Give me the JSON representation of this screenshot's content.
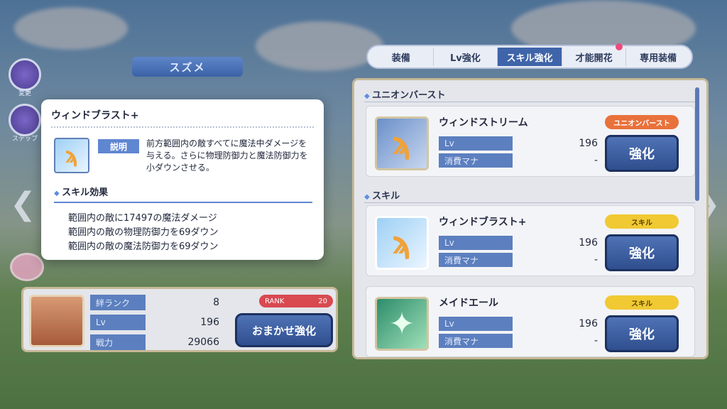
{
  "character": {
    "name": "スズメ"
  },
  "side_buttons": [
    {
      "label": "変更"
    },
    {
      "label": "ステップ"
    }
  ],
  "tabs": [
    {
      "label": "装備",
      "active": false
    },
    {
      "label": "Lv強化",
      "active": false
    },
    {
      "label": "スキル強化",
      "active": true
    },
    {
      "label": "才能開花",
      "active": false,
      "notify": true
    },
    {
      "label": "専用装備",
      "active": false
    }
  ],
  "sections": {
    "union_burst": "ユニオンバースト",
    "skill": "スキル"
  },
  "skills": [
    {
      "name": "ウィンドストリーム",
      "badge": "ユニオンバースト",
      "lv_label": "Lv",
      "lv": "196",
      "mana_label": "消費マナ",
      "mana": "-",
      "button": "強化",
      "icon": "wind-staff-icon"
    },
    {
      "name": "ウィンドブラスト+",
      "badge": "スキル",
      "lv_label": "Lv",
      "lv": "196",
      "mana_label": "消費マナ",
      "mana": "-",
      "button": "強化",
      "icon": "wind-staff-icon"
    },
    {
      "name": "メイドエール",
      "badge": "スキル",
      "lv_label": "Lv",
      "lv": "196",
      "mana_label": "消費マナ",
      "mana": "-",
      "button": "強化",
      "icon": "sparkle-sword-icon"
    }
  ],
  "status": {
    "bond_label": "絆ランク",
    "bond": "8",
    "lv_label": "Lv",
    "lv": "196",
    "power_label": "戦力",
    "power": "29066",
    "rank_label": "RANK",
    "rank": "20",
    "auto_button": "おまかせ強化"
  },
  "popup": {
    "title": "ウィンドブラスト+",
    "desc_tag": "説明",
    "description": "前方範囲内の敵すべてに魔法中ダメージを与える。さらに物理防御力と魔法防御力を小ダウンさせる。",
    "effects_title": "スキル効果",
    "effects": [
      "範囲内の敵に17497の魔法ダメージ",
      "範囲内の敵の物理防御力を69ダウン",
      "範囲内の敵の魔法防御力を69ダウン"
    ]
  },
  "colors": {
    "accent": "#3f64a9",
    "union_badge": "#e9713b",
    "skill_badge": "#f0c933",
    "rank": "#d94950"
  }
}
